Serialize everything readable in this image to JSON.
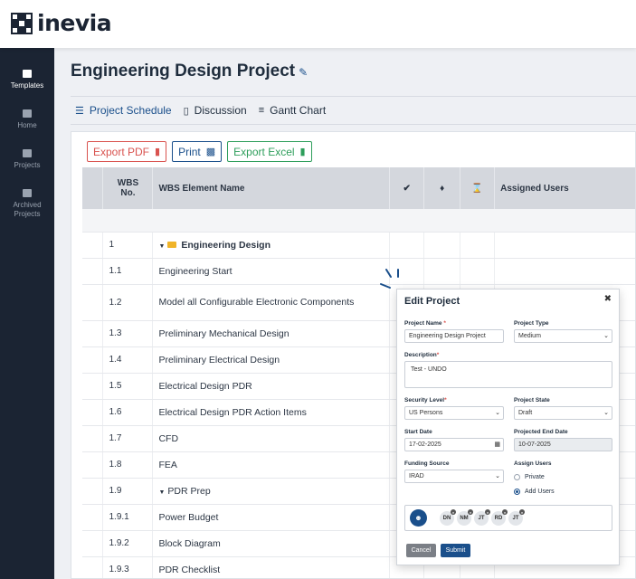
{
  "brand": {
    "name": "inevia"
  },
  "sidebar": {
    "items": [
      {
        "label": "Templates",
        "icon": "templates-icon",
        "active": true
      },
      {
        "label": "Home",
        "icon": "home-icon",
        "active": false
      },
      {
        "label": "Projects",
        "icon": "folder-icon",
        "active": false
      },
      {
        "label": "Archived Projects",
        "icon": "archive-icon",
        "active": false
      }
    ]
  },
  "page": {
    "title": "Engineering Design Project"
  },
  "tabs": [
    {
      "label": "Project Schedule",
      "icon": "list-icon",
      "active": true
    },
    {
      "label": "Discussion",
      "icon": "chat-icon",
      "active": false
    },
    {
      "label": "Gantt Chart",
      "icon": "gantt-icon",
      "active": false
    }
  ],
  "toolbar": {
    "pdf": "Export PDF",
    "print": "Print",
    "excel": "Export Excel"
  },
  "table": {
    "headers": {
      "wbs": "WBS No.",
      "name": "WBS Element Name",
      "assigned": "Assigned Users"
    },
    "rows": [
      {
        "wbs": "1",
        "name": "Engineering Design"
      },
      {
        "wbs": "1.1",
        "name": "Engineering Start"
      },
      {
        "wbs": "1.2",
        "name": "Model all Configurable Electronic Components"
      },
      {
        "wbs": "1.3",
        "name": "Preliminary Mechanical Design"
      },
      {
        "wbs": "1.4",
        "name": "Preliminary Electrical Design"
      },
      {
        "wbs": "1.5",
        "name": "Electrical Design PDR"
      },
      {
        "wbs": "1.6",
        "name": "Electrical Design PDR Action Items"
      },
      {
        "wbs": "1.7",
        "name": "CFD"
      },
      {
        "wbs": "1.8",
        "name": "FEA"
      },
      {
        "wbs": "1.9",
        "name": "PDR Prep"
      },
      {
        "wbs": "1.9.1",
        "name": "Power Budget"
      },
      {
        "wbs": "1.9.2",
        "name": "Block Diagram"
      },
      {
        "wbs": "1.9.3",
        "name": "PDR Checklist"
      }
    ]
  },
  "modal": {
    "title": "Edit Project",
    "project_name": {
      "label": "Project Name",
      "value": "Engineering Design Project"
    },
    "project_type": {
      "label": "Project Type",
      "value": "Medium"
    },
    "description": {
      "label": "Description",
      "value": "Test - UNDO"
    },
    "security_level": {
      "label": "Security Level",
      "value": "US Persons"
    },
    "project_state": {
      "label": "Project State",
      "value": "Draft"
    },
    "start_date": {
      "label": "Start Date",
      "value": "17-02-2025"
    },
    "projected_end_date": {
      "label": "Projected End Date",
      "value": "10-07-2025"
    },
    "funding_source": {
      "label": "Funding Source",
      "value": "IRAD"
    },
    "assign_users": {
      "label": "Assign Users",
      "private": "Private",
      "add_users": "Add Users",
      "selected": "Add Users"
    },
    "users": [
      "DN",
      "NM",
      "JT",
      "RD",
      "JT"
    ],
    "cancel": "Cancel",
    "submit": "Submit"
  },
  "colors": {
    "primary": "#1a4f8b",
    "sidebar": "#1b2433",
    "pdf": "#d9534f",
    "excel": "#2e9e5b"
  }
}
